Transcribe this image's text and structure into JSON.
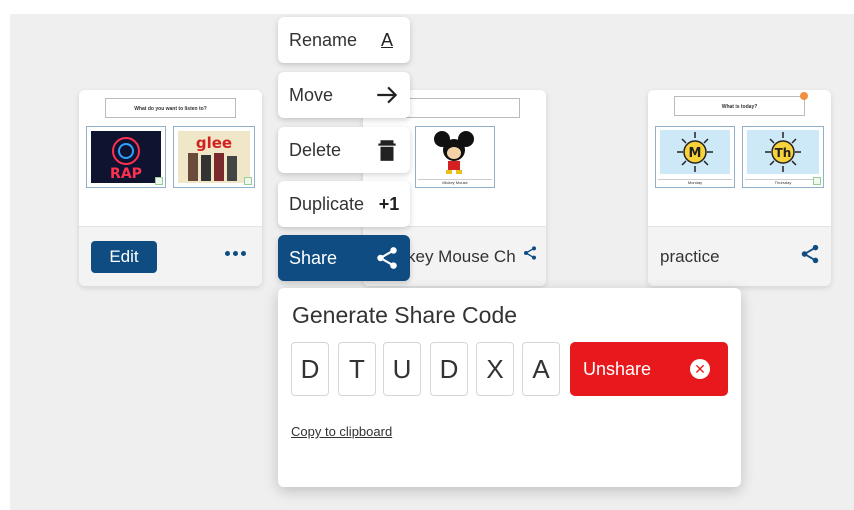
{
  "cards": [
    {
      "question": "What do you want to listen to?",
      "tiles": [
        {
          "label": ""
        },
        {
          "label": ""
        }
      ],
      "edit_label": "Edit"
    },
    {
      "tiles": [
        {
          "label": "Mickey Mouse"
        }
      ],
      "title": "key Mouse Ch"
    },
    {
      "question": "What is today?",
      "tiles": [
        {
          "label": "Monday"
        },
        {
          "label": "Thursday"
        }
      ],
      "title": "practice"
    }
  ],
  "menu": {
    "rename": "Rename",
    "rename_icon": "A",
    "move": "Move",
    "delete": "Delete",
    "duplicate": "Duplicate",
    "duplicate_icon": "+1",
    "share": "Share"
  },
  "share_panel": {
    "title": "Generate Share Code",
    "code": [
      "D",
      "T",
      "U",
      "D",
      "X",
      "A"
    ],
    "unshare_label": "Unshare",
    "copy_label": "Copy to clipboard"
  },
  "colors": {
    "primary": "#0f4c81",
    "danger": "#e8191d",
    "background": "#efefef"
  }
}
